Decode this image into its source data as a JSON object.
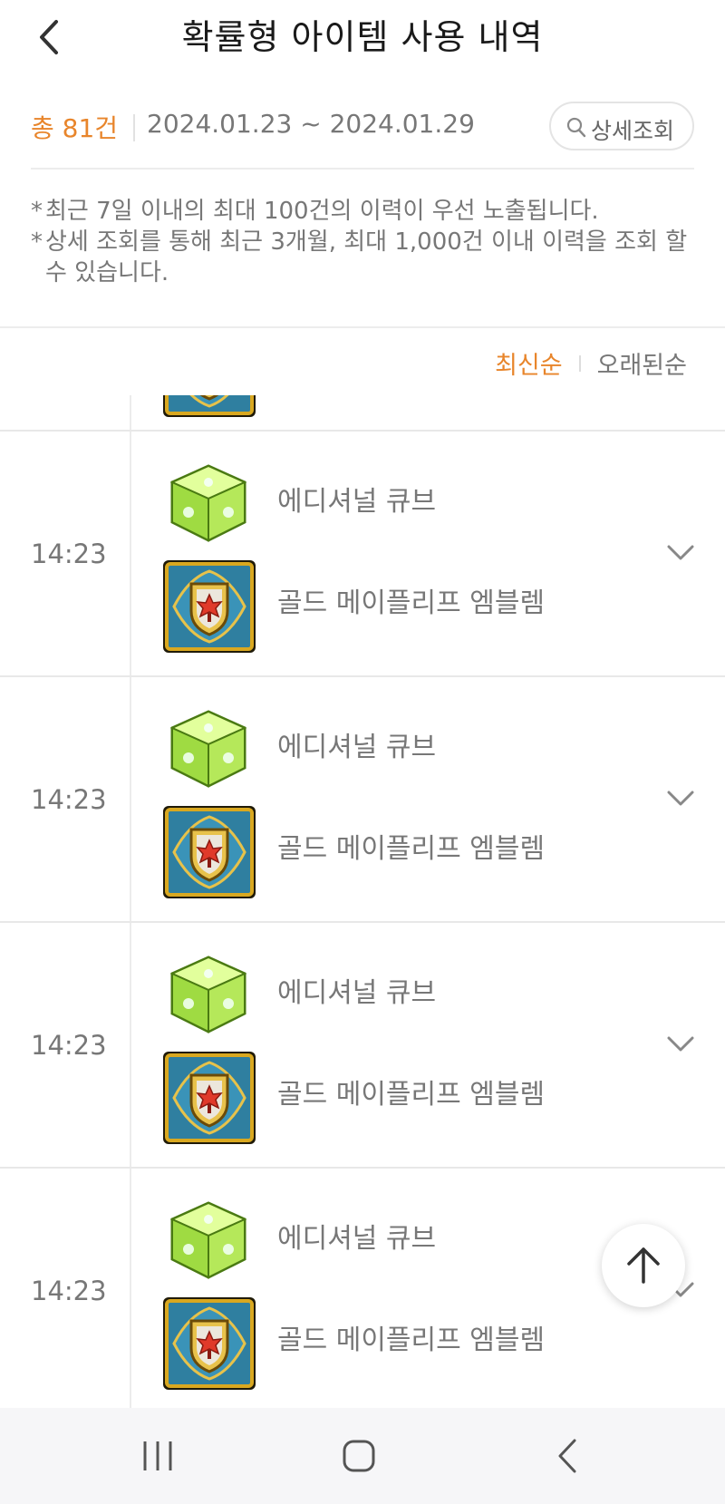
{
  "header": {
    "title": "확률형 아이템 사용 내역"
  },
  "summary": {
    "total": "총 81건",
    "date_range": "2024.01.23 ~ 2024.01.29",
    "detail_button": "상세조회"
  },
  "notes": [
    "최근 7일 이내의 최대 100건의 이력이 우선 노출됩니다.",
    "상세 조회를 통해 최근 3개월, 최대 1,000건 이내 이력을 조회 할 수 있습니다."
  ],
  "sort": {
    "newest": "최신순",
    "oldest": "오래된순"
  },
  "records": [
    {
      "time": "14:23",
      "item1": "에디셔널 큐브",
      "item2": "골드 메이플리프 엠블렘"
    },
    {
      "time": "14:23",
      "item1": "에디셔널 큐브",
      "item2": "골드 메이플리프 엠블렘"
    },
    {
      "time": "14:23",
      "item1": "에디셔널 큐브",
      "item2": "골드 메이플리프 엠블렘"
    },
    {
      "time": "14:23",
      "item1": "에디셔널 큐브",
      "item2": "골드 메이플리프 엠블렘"
    }
  ],
  "colors": {
    "accent": "#e8852b",
    "text_muted": "#777777",
    "cube_green": "#a6e24a",
    "emblem_blue": "#2f7fa0",
    "emblem_gold": "#d9a820"
  },
  "icons": [
    "chevron-left-icon",
    "search-icon",
    "chevron-down-icon",
    "arrow-up-icon",
    "recents-icon",
    "home-icon",
    "back-icon",
    "additional-cube-icon",
    "gold-maple-leaf-emblem-icon"
  ]
}
